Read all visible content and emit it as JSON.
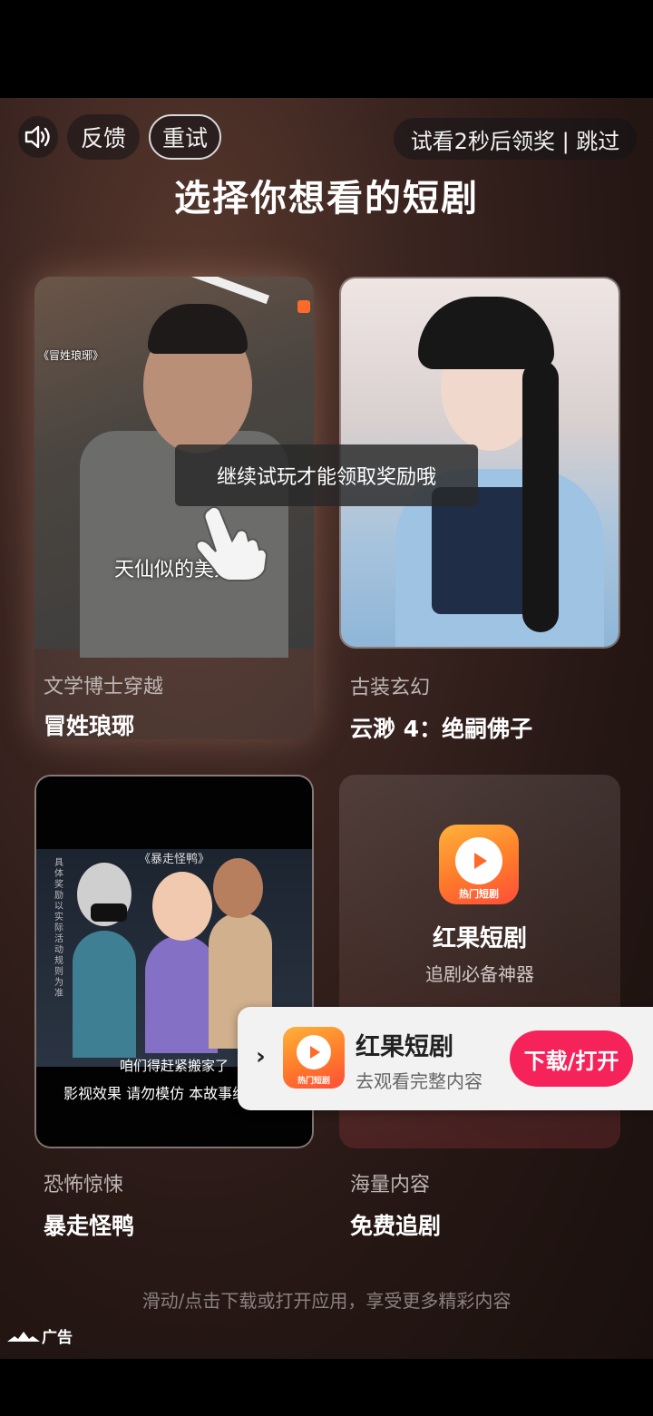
{
  "controls": {
    "sound_icon": "speaker-icon",
    "feedback_label": "反馈",
    "retry_label": "重试",
    "skip_label": "试看2秒后领奖 | 跳过"
  },
  "title": "选择你想看的短剧",
  "cards": [
    {
      "genre": "文学博士穿越",
      "name": "冒姓琅琊",
      "drama_tag": "《冒姓琅琊》",
      "subtitle": "天仙似的美人"
    },
    {
      "genre": "古装玄幻",
      "name": "云渺 4：绝嗣佛子"
    },
    {
      "genre": "恐怖惊悚",
      "name": "暴走怪鸭",
      "drama_title": "《暴走怪鸭》",
      "vertical_note": "具体奖励以实际活动规则为准",
      "subtitle_1": "咱们得赶紧搬家了",
      "subtitle_2": "影视效果 请勿模仿 本故事纯"
    },
    {
      "genre": "海量内容",
      "name": "免费追剧",
      "app_name": "红果短剧",
      "app_slogan": "追剧必备神器",
      "icon_caption": "热门短剧"
    }
  ],
  "toast": "继续试玩才能领取奖励哦",
  "download_banner": {
    "app_name": "红果短剧",
    "description": "去观看完整内容",
    "button_label": "下载/打开",
    "icon_caption": "热门短剧"
  },
  "bottom_hint": "滑动/点击下载或打开应用，享受更多精彩内容",
  "ad_label": "广告",
  "colors": {
    "cta": "#f5235a",
    "brand_orange": "#ff7a2a"
  }
}
